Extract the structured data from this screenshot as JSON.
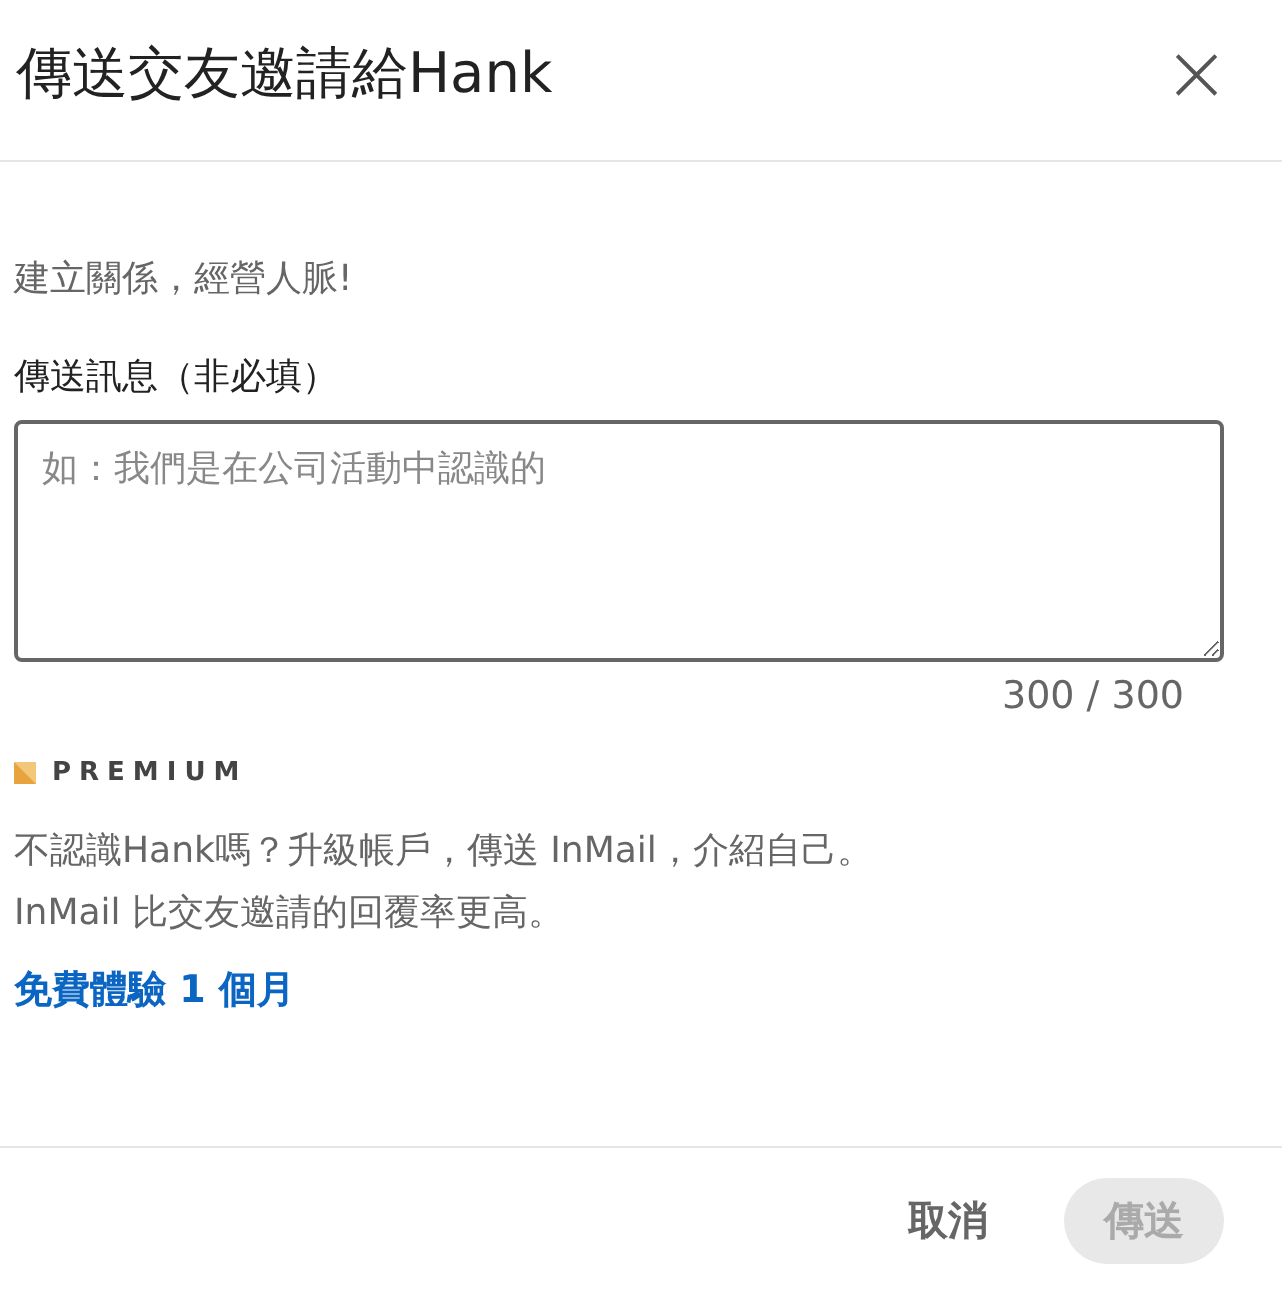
{
  "dialog": {
    "title": "傳送交友邀請給Hank",
    "close": "×"
  },
  "subtitle": "建立關係，經營人脈!",
  "message": {
    "label": "傳送訊息（非必填）",
    "placeholder": "如：我們是在公司活動中認識的",
    "counter": "300 / 300"
  },
  "premium": {
    "badge": "PREMIUM",
    "lines": [
      "不認識Hank嗎？升級帳戶，傳送 InMail，介紹自己。",
      "InMail 比交友邀請的回覆率更高。"
    ],
    "link": "免費體驗 1 個月"
  },
  "buttons": [
    {
      "label": "取消",
      "kind": "text",
      "disabled": false
    },
    {
      "label": "傳送",
      "kind": "primary",
      "disabled": true
    }
  ]
}
